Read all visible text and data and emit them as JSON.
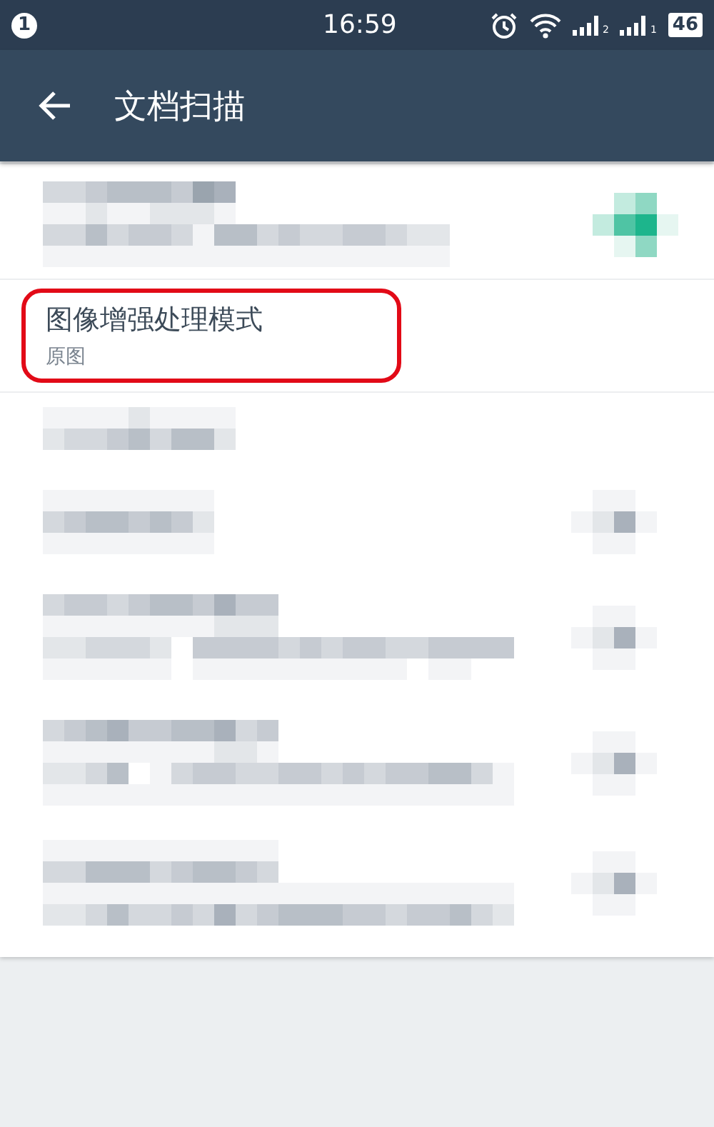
{
  "status_bar": {
    "notification_count": "1",
    "time": "16:59",
    "sims": [
      {
        "label": "2"
      },
      {
        "label": "1"
      }
    ],
    "battery": "46"
  },
  "app_bar": {
    "title": "文档扫描"
  },
  "settings": [
    {
      "kind": "obscured_icon"
    },
    {
      "kind": "text",
      "title": "图像增强处理模式",
      "summary": "原图",
      "highlighted": true
    },
    {
      "kind": "obscured"
    },
    {
      "kind": "obscured_icon"
    },
    {
      "kind": "obscured_icon"
    },
    {
      "kind": "obscured_icon"
    },
    {
      "kind": "obscured_icon"
    }
  ]
}
